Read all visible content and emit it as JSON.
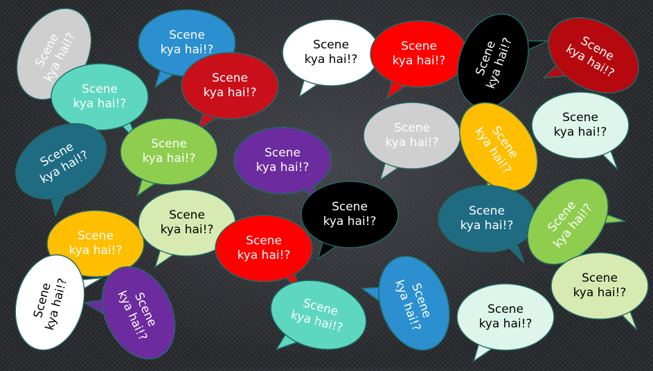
{
  "phrase": {
    "line1": "Scene",
    "line2": "kya hai!?"
  },
  "colors": {
    "background": "#2a2c30",
    "outline": "#1f6b66",
    "light_gray": "#cfcfcf",
    "blue": "#2b8fd0",
    "red": "#c9101a",
    "bright_red": "#ff0000",
    "white": "#ffffff",
    "black": "#000000",
    "dark_red": "#b5090f",
    "mint": "#5ed7c1",
    "lime": "#8fcd4f",
    "purple": "#6c2b9f",
    "teal": "#1e6b82",
    "orange": "#ffbe00",
    "pale_mint": "#ddf5ea",
    "pale_lime": "#d7eab1"
  }
}
